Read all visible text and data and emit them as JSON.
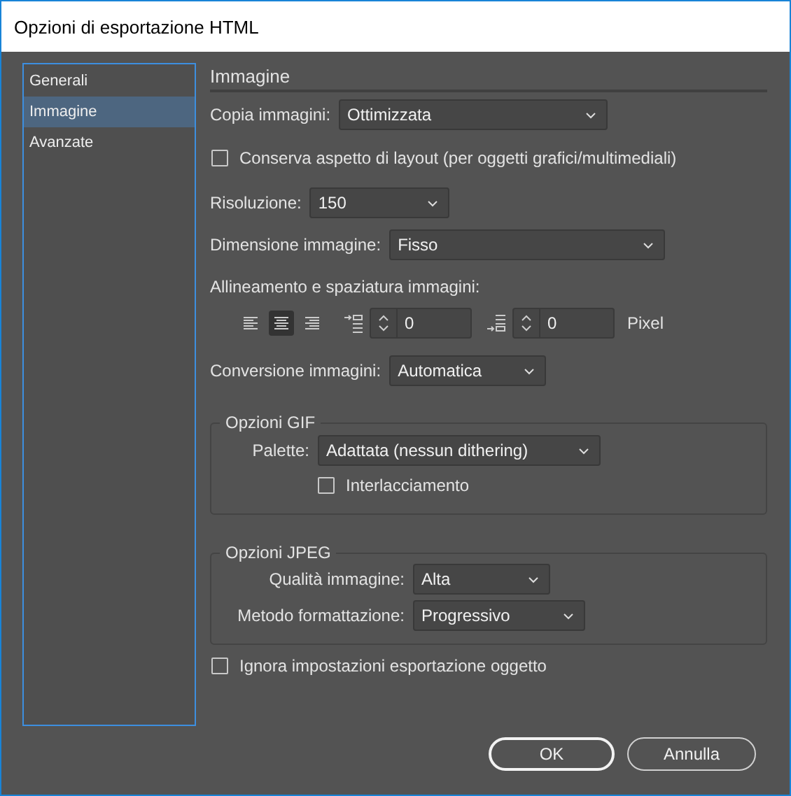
{
  "window": {
    "title": "Opzioni di esportazione HTML"
  },
  "sidebar": {
    "items": [
      {
        "label": "Generali",
        "selected": false
      },
      {
        "label": "Immagine",
        "selected": true
      },
      {
        "label": "Avanzate",
        "selected": false
      }
    ]
  },
  "section": {
    "title": "Immagine"
  },
  "fields": [
    {
      "kind": "select",
      "label": "Copia immagini:",
      "value": "Ottimizzata"
    },
    {
      "kind": "checkbox",
      "label": "Conserva aspetto di layout (per oggetti grafici/multimediali)",
      "checked": false
    },
    {
      "kind": "select",
      "label": "Risoluzione:",
      "value": "150"
    },
    {
      "kind": "select",
      "label": "Dimensione immagine:",
      "value": "Fisso"
    }
  ],
  "alignment": {
    "label": "Allineamento e spaziatura immagini:",
    "options": [
      {
        "selected": false
      },
      {
        "selected": true
      },
      {
        "selected": false
      }
    ],
    "space_before": "0",
    "space_after": "0",
    "unit": "Pixel"
  },
  "conversion": {
    "label": "Conversione immagini:",
    "value": "Automatica"
  },
  "gif_options": {
    "title": "Opzioni GIF",
    "palette": {
      "label": "Palette:",
      "value": "Adattata (nessun dithering)"
    },
    "interlace": {
      "label": "Interlacciamento",
      "checked": false
    }
  },
  "jpeg_options": {
    "title": "Opzioni JPEG",
    "fields": [
      {
        "label": "Qualità immagine:",
        "value": "Alta"
      },
      {
        "label": "Metodo formattazione:",
        "value": "Progressivo"
      }
    ]
  },
  "ignore_object_settings": {
    "label": "Ignora impostazioni esportazione oggetto",
    "checked": false
  },
  "buttons": [
    {
      "label": "OK",
      "kind": "default"
    },
    {
      "label": "Annulla",
      "kind": "normal"
    }
  ]
}
